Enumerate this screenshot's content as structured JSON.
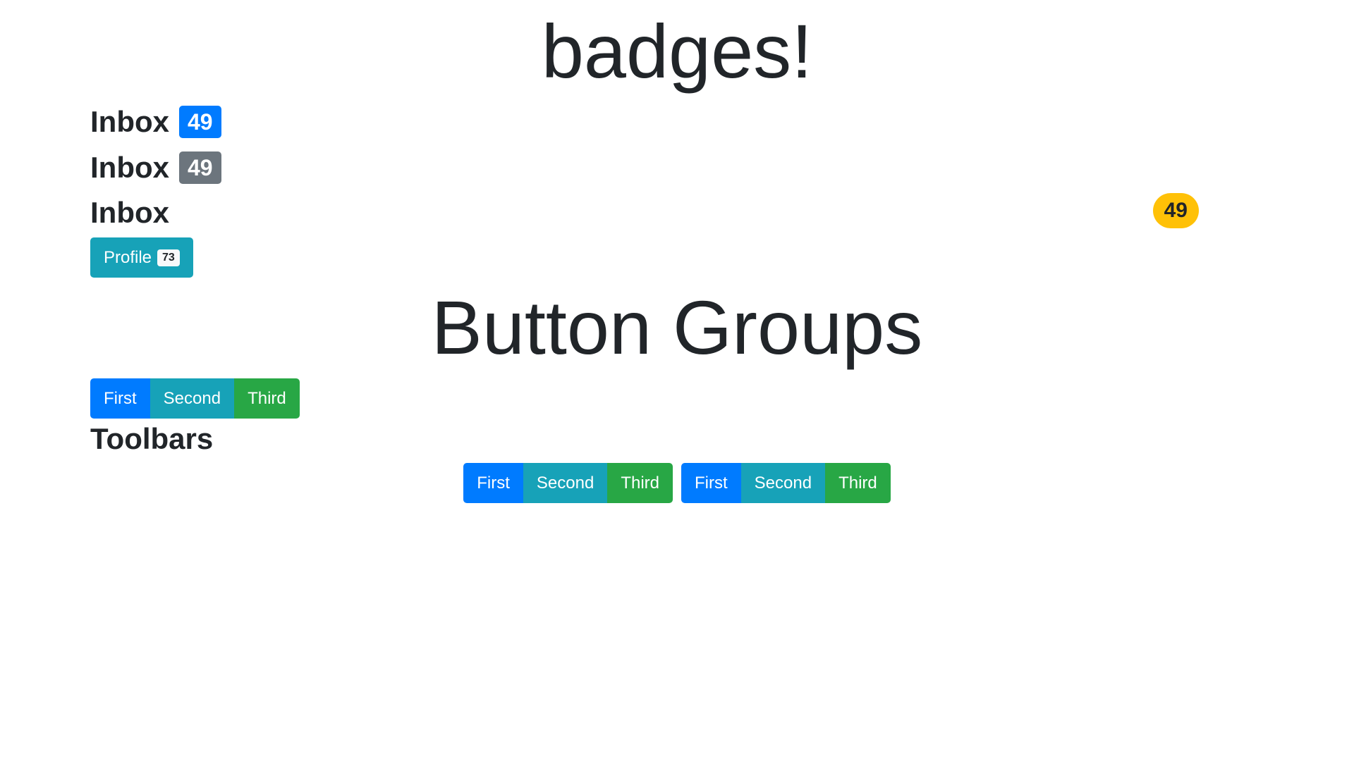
{
  "badges_section": {
    "title": "badges!",
    "inbox_primary": {
      "label": "Inbox",
      "count": "49"
    },
    "inbox_secondary": {
      "label": "Inbox",
      "count": "49"
    },
    "inbox_plain": {
      "label": "Inbox"
    },
    "warning_pill": {
      "count": "49"
    },
    "profile_button": {
      "label": "Profile",
      "count": "73"
    }
  },
  "button_groups_section": {
    "title": "Button Groups",
    "group": [
      "First",
      "Second",
      "Third"
    ]
  },
  "toolbars_section": {
    "title": "Toolbars",
    "groups": [
      [
        "First",
        "Second",
        "Third"
      ],
      [
        "First",
        "Second",
        "Third"
      ]
    ]
  },
  "colors": {
    "primary": "#007bff",
    "secondary": "#6c757d",
    "info": "#17a2b8",
    "success": "#28a745",
    "warning": "#ffc107",
    "light": "#f8f9fa",
    "text": "#212529"
  }
}
